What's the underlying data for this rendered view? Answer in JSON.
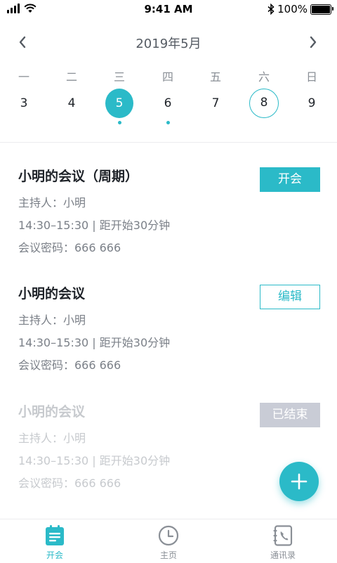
{
  "status_bar": {
    "time": "9:41 AM",
    "battery_percent": "100%",
    "battery_level": 1.0
  },
  "calendar": {
    "month_title": "2019年5月",
    "weekdays": [
      "一",
      "二",
      "三",
      "四",
      "五",
      "六",
      "日"
    ],
    "dates": [
      {
        "day": "3"
      },
      {
        "day": "4"
      },
      {
        "day": "5",
        "selected": true,
        "has_event": true
      },
      {
        "day": "6",
        "has_event": true
      },
      {
        "day": "7"
      },
      {
        "day": "8",
        "today": true
      },
      {
        "day": "9"
      }
    ]
  },
  "meetings": [
    {
      "title": "小明的会议（周期）",
      "host": "主持人：小明",
      "time": "14:30–15:30 | 距开始30分钟",
      "password": "会议密码：666 666",
      "action": "开会",
      "status": "upcoming"
    },
    {
      "title": "小明的会议",
      "host": "主持人：小明",
      "time": "14:30–15:30 | 距开始30分钟",
      "password": "会议密码：666 666",
      "action": "编辑",
      "status": "editable"
    },
    {
      "title": "小明的会议",
      "host": "主持人：小明",
      "time": "14:30–15:30 | 距开始30分钟",
      "password": "会议密码：666 666",
      "action": "已结束",
      "status": "ended"
    }
  ],
  "tabs": [
    {
      "label": "开会",
      "icon": "meeting-icon",
      "active": true
    },
    {
      "label": "主页",
      "icon": "clock-icon",
      "active": false
    },
    {
      "label": "通讯录",
      "icon": "contacts-icon",
      "active": false
    }
  ],
  "colors": {
    "accent": "#2bbac8",
    "disabled": "#c9ccd6"
  }
}
